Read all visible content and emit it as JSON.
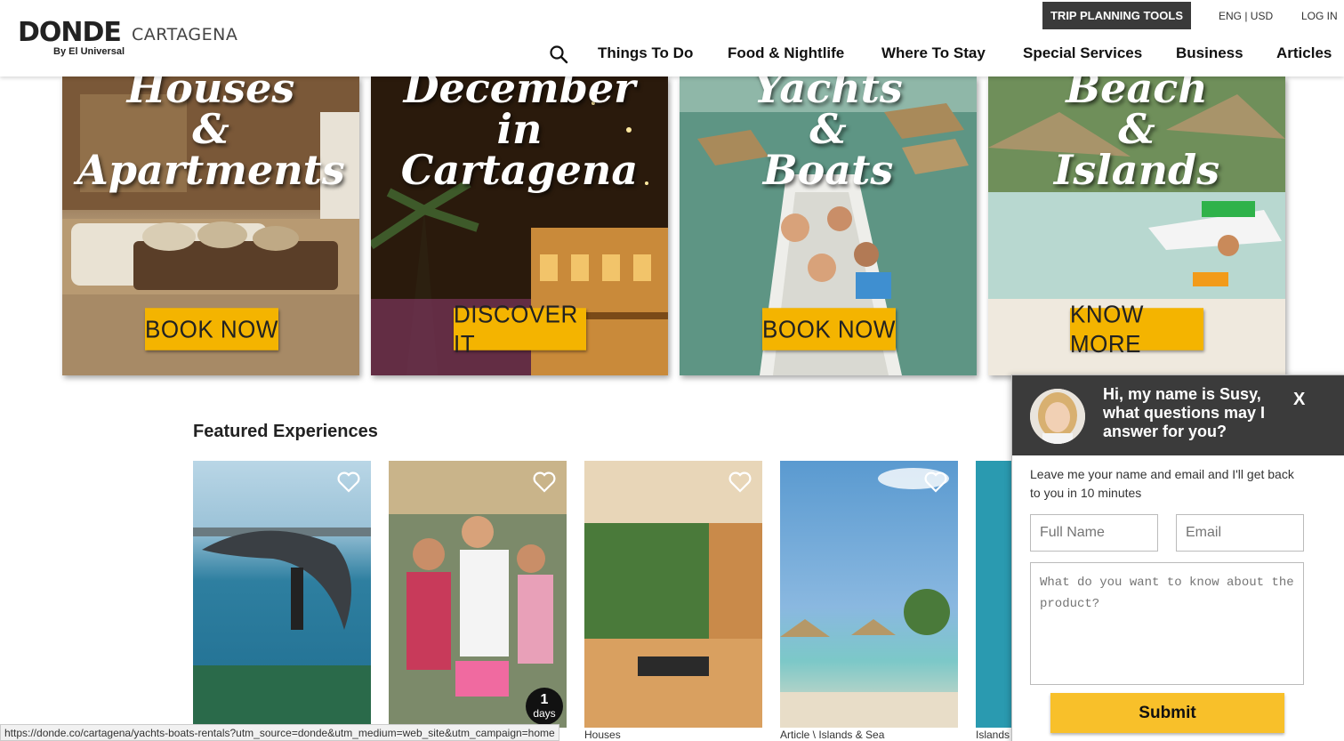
{
  "header": {
    "logo_text": "DONDE",
    "logo_city": "CARTAGENA",
    "logo_by": "By El Universal",
    "trip_tools": "TRIP PLANNING TOOLS",
    "lang_currency": "ENG | USD",
    "login": "LOG IN",
    "nav": [
      "Things To Do",
      "Food & Nightlife",
      "Where To Stay",
      "Special Services",
      "Business",
      "Articles"
    ]
  },
  "banners": [
    {
      "title_lines": [
        "Houses",
        "&",
        "Apartments"
      ],
      "button": "BOOK NOW"
    },
    {
      "title_lines": [
        "December",
        "in",
        "Cartagena"
      ],
      "button": "DISCOVER IT"
    },
    {
      "title_lines": [
        "Yachts",
        "&",
        "Boats"
      ],
      "button": "BOOK NOW"
    },
    {
      "title_lines": [
        "Beach",
        "&",
        "Islands"
      ],
      "button": "KNOW MORE"
    }
  ],
  "featured": {
    "title": "Featured Experiences",
    "items": [
      {
        "caption": ""
      },
      {
        "caption": "",
        "badge_number": "1",
        "badge_unit": "days"
      },
      {
        "caption": "Houses"
      },
      {
        "caption": "Article \\ Islands & Sea"
      },
      {
        "caption": "Islands"
      }
    ]
  },
  "status_bar_url": "https://donde.co/cartagena/yachts-boats-rentals?utm_source=donde&utm_medium=web_site&utm_campaign=home",
  "chat": {
    "greeting": "Hi, my name is Susy, what questions may I answer for you?",
    "close": "X",
    "intro": "Leave me your name and email and I'll get back to you in 10 minutes",
    "name_placeholder": "Full Name",
    "email_placeholder": "Email",
    "message_placeholder": "What do you want to know about the product?",
    "submit": "Submit"
  },
  "colors": {
    "accent_yellow": "#f4b400",
    "header_dark": "#3a3a3a"
  }
}
